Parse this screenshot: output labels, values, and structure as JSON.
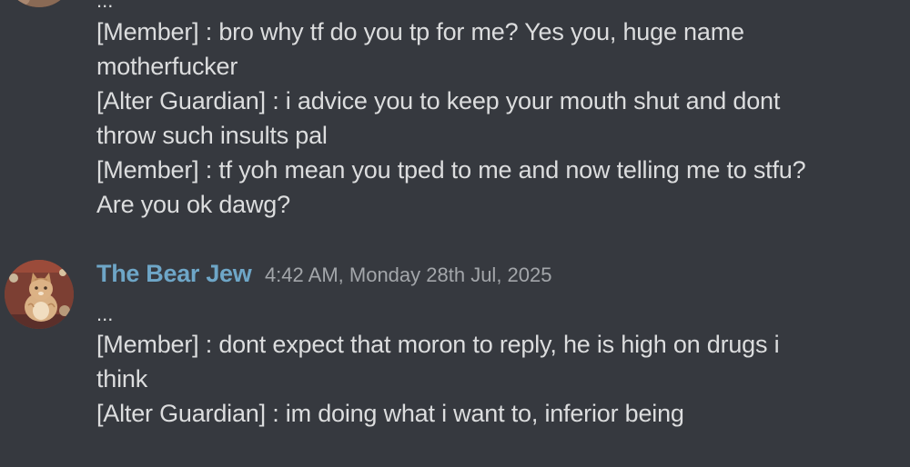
{
  "messages": [
    {
      "preview": "...",
      "lines": [
        "[Member] : bro why tf do you tp for me? Yes you, huge name",
        "motherfucker",
        "[Alter Guardian] : i advice you to keep your mouth shut and dont",
        "throw such insults pal",
        "[Member] : tf yoh mean you tped to me and now telling me to stfu?",
        "Are you ok dawg?"
      ]
    },
    {
      "author": "The Bear Jew",
      "timestamp": "4:42 AM, Monday 28th Jul, 2025",
      "preview": "...",
      "lines": [
        "[Member] : dont expect that moron to reply, he is high on drugs i",
        "think",
        "[Alter Guardian] : im doing what i want to, inferior being"
      ]
    }
  ],
  "colors": {
    "background": "#36393f",
    "username": "#6ea6c7",
    "text": "#dcddde",
    "timestamp": "#a3a6aa"
  }
}
